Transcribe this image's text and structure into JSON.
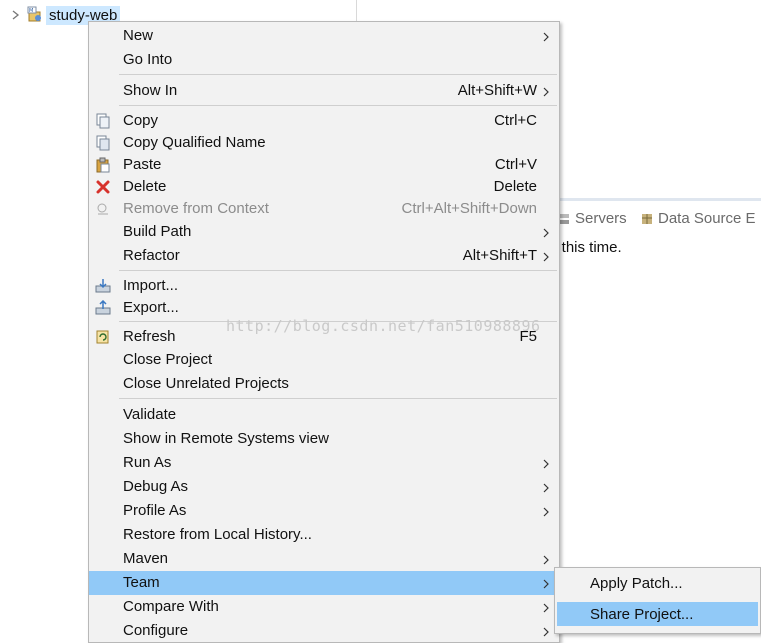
{
  "explorer": {
    "project_name": "study-web"
  },
  "views": {
    "tabs": [
      {
        "label": "Servers",
        "icon": "servers-icon"
      },
      {
        "label": "Data Source E",
        "icon": "data-source-icon"
      }
    ],
    "message": "at this time."
  },
  "context_menu": {
    "items": [
      {
        "label": "New",
        "shortcut": "",
        "submenu": true,
        "icon": ""
      },
      {
        "label": "Go Into",
        "shortcut": "",
        "submenu": false,
        "icon": ""
      },
      {
        "label": "Show In",
        "shortcut": "Alt+Shift+W",
        "submenu": true,
        "icon": ""
      },
      {
        "label": "Copy",
        "shortcut": "Ctrl+C",
        "submenu": false,
        "icon": "copy-icon"
      },
      {
        "label": "Copy Qualified Name",
        "shortcut": "",
        "submenu": false,
        "icon": "copy-qualified-icon"
      },
      {
        "label": "Paste",
        "shortcut": "Ctrl+V",
        "submenu": false,
        "icon": "paste-icon"
      },
      {
        "label": "Delete",
        "shortcut": "Delete",
        "submenu": false,
        "icon": "delete-icon"
      },
      {
        "label": "Remove from Context",
        "shortcut": "Ctrl+Alt+Shift+Down",
        "submenu": false,
        "icon": "remove-context-icon",
        "disabled": true
      },
      {
        "label": "Build Path",
        "shortcut": "",
        "submenu": true,
        "icon": ""
      },
      {
        "label": "Refactor",
        "shortcut": "Alt+Shift+T",
        "submenu": true,
        "icon": ""
      },
      {
        "label": "Import...",
        "shortcut": "",
        "submenu": false,
        "icon": "import-icon"
      },
      {
        "label": "Export...",
        "shortcut": "",
        "submenu": false,
        "icon": "export-icon"
      },
      {
        "label": "Refresh",
        "shortcut": "F5",
        "submenu": false,
        "icon": "refresh-icon"
      },
      {
        "label": "Close Project",
        "shortcut": "",
        "submenu": false,
        "icon": ""
      },
      {
        "label": "Close Unrelated Projects",
        "shortcut": "",
        "submenu": false,
        "icon": ""
      },
      {
        "label": "Validate",
        "shortcut": "",
        "submenu": false,
        "icon": ""
      },
      {
        "label": "Show in Remote Systems view",
        "shortcut": "",
        "submenu": false,
        "icon": ""
      },
      {
        "label": "Run As",
        "shortcut": "",
        "submenu": true,
        "icon": ""
      },
      {
        "label": "Debug As",
        "shortcut": "",
        "submenu": true,
        "icon": ""
      },
      {
        "label": "Profile As",
        "shortcut": "",
        "submenu": true,
        "icon": ""
      },
      {
        "label": "Restore from Local History...",
        "shortcut": "",
        "submenu": false,
        "icon": ""
      },
      {
        "label": "Maven",
        "shortcut": "",
        "submenu": true,
        "icon": ""
      },
      {
        "label": "Team",
        "shortcut": "",
        "submenu": true,
        "icon": "",
        "selected": true
      },
      {
        "label": "Compare With",
        "shortcut": "",
        "submenu": true,
        "icon": ""
      },
      {
        "label": "Configure",
        "shortcut": "",
        "submenu": true,
        "icon": ""
      }
    ]
  },
  "team_submenu": {
    "items": [
      {
        "label": "Apply Patch..."
      },
      {
        "label": "Share Project...",
        "selected": true
      }
    ]
  },
  "watermark": "http://blog.csdn.net/fan510988896",
  "colors": {
    "menu_bg": "#f2f2f2",
    "selection": "#91c9f7",
    "project_highlight": "#cde8ff"
  }
}
